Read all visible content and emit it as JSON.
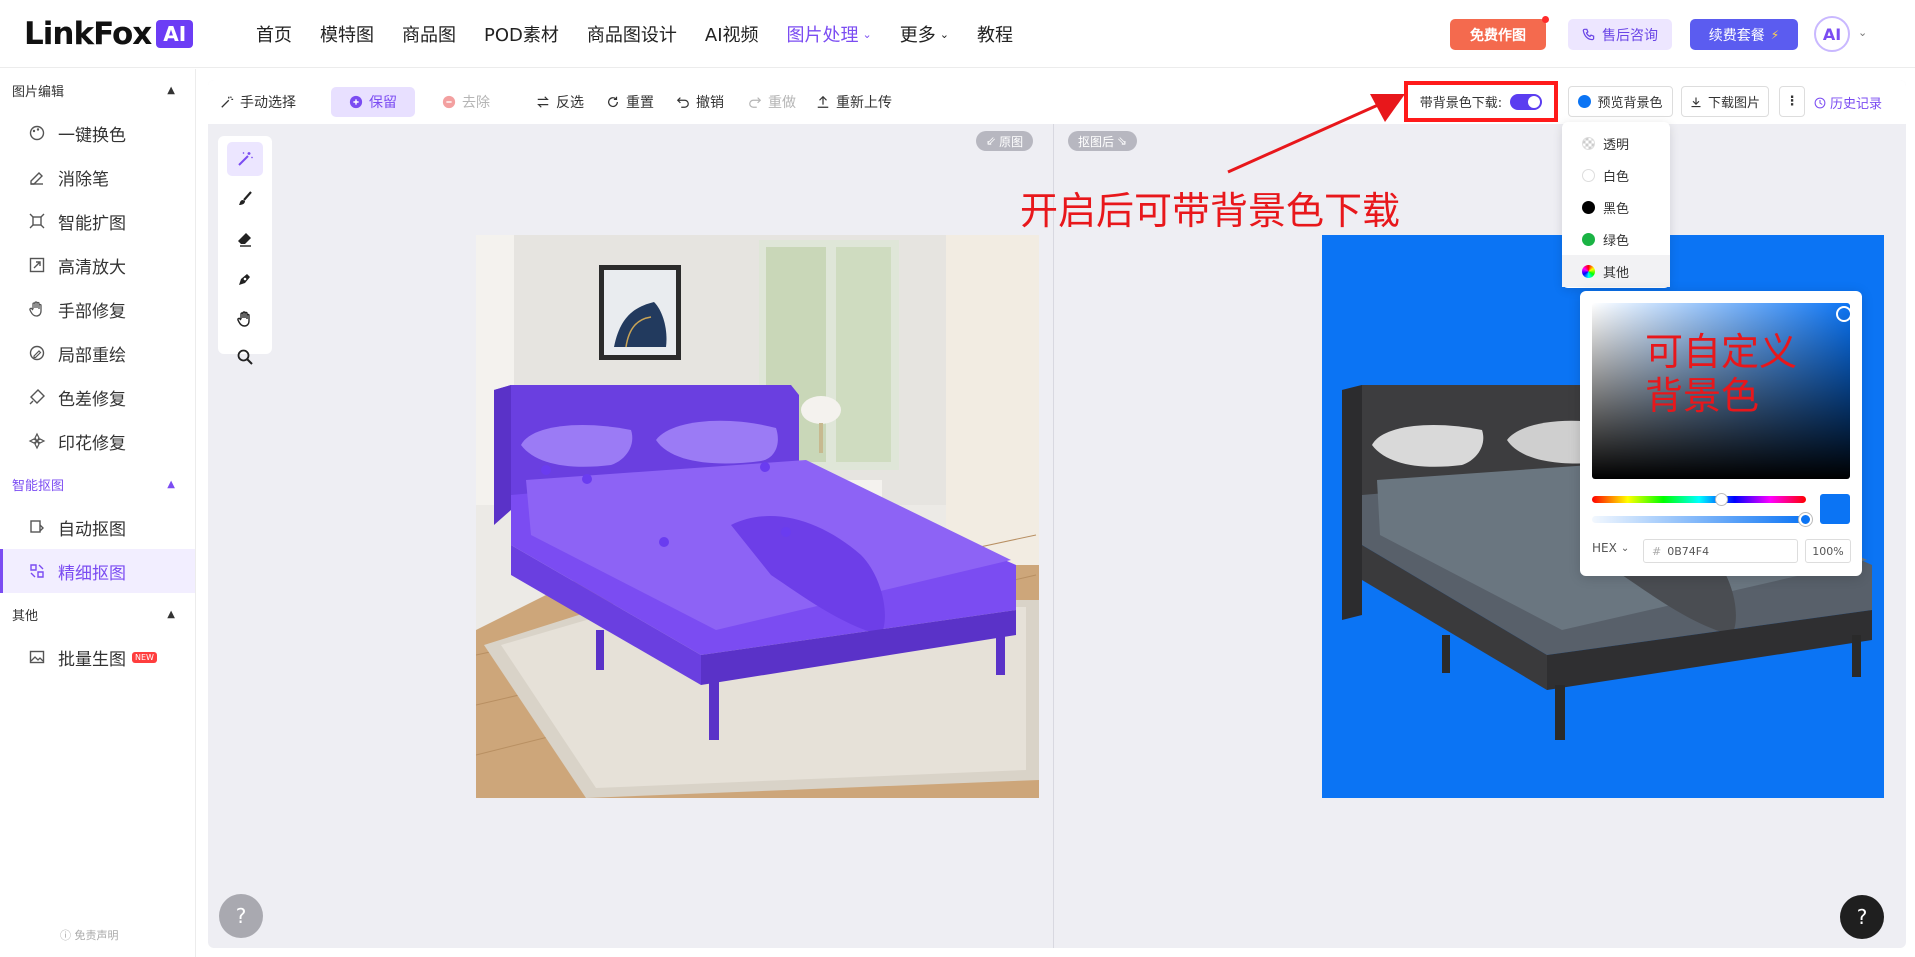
{
  "brand": {
    "name": "LinkFox",
    "badge": "AI"
  },
  "nav": {
    "items": [
      {
        "label": "首页"
      },
      {
        "label": "模特图"
      },
      {
        "label": "商品图"
      },
      {
        "label": "POD素材"
      },
      {
        "label": "商品图设计"
      },
      {
        "label": "AI视频"
      },
      {
        "label": "图片处理",
        "active": true
      },
      {
        "label": "更多"
      },
      {
        "label": "教程"
      }
    ],
    "free_btn": "免费作图",
    "service_btn": "售后咨询",
    "renew_btn": "续费套餐",
    "avatar": "AI"
  },
  "sidebar": {
    "sections": [
      {
        "title": "图片编辑",
        "items": [
          "一键换色",
          "消除笔",
          "智能扩图",
          "高清放大",
          "手部修复",
          "局部重绘",
          "色差修复",
          "印花修复"
        ]
      },
      {
        "title": "智能抠图",
        "items": [
          "自动抠图",
          "精细抠图"
        ]
      },
      {
        "title": "其他",
        "items": [
          "批量生图"
        ]
      }
    ],
    "active_item": "精细抠图",
    "new_badge": "NEW",
    "disclaimer": "免责声明"
  },
  "toolbar": {
    "manual_select": "手动选择",
    "keep": "保留",
    "remove": "去除",
    "invert": "反选",
    "reset": "重置",
    "undo": "撤销",
    "redo": "重做",
    "reupload": "重新上传",
    "bg_download_label": "带背景色下载:",
    "bg_download_enabled": true,
    "preview_bg": "预览背景色",
    "download": "下载图片",
    "history": "历史记录"
  },
  "canvas": {
    "original_label": "原图",
    "cutout_label": "抠图后",
    "help": "?"
  },
  "bg_menu": {
    "items": [
      {
        "label": "透明",
        "swatch": "checker"
      },
      {
        "label": "白色",
        "swatch": "#ffffff"
      },
      {
        "label": "黑色",
        "swatch": "#000000"
      },
      {
        "label": "绿色",
        "swatch": "#1ab344"
      },
      {
        "label": "其他",
        "swatch": "rainbow"
      }
    ],
    "selected": "其他"
  },
  "color_picker": {
    "format": "HEX",
    "hex_value": "0B74F4",
    "alpha": "100%",
    "color": "#0b74f4",
    "hue_fraction": 0.6,
    "alpha_fraction": 1.0
  },
  "annotations": {
    "tip_1": "开启后可带背景色下载",
    "tip_2": "可自定义背景色"
  },
  "colors": {
    "accent": "#7b4cf2",
    "highlight_red": "#ff1a1a",
    "cutout_bg": "#0b74f4"
  }
}
